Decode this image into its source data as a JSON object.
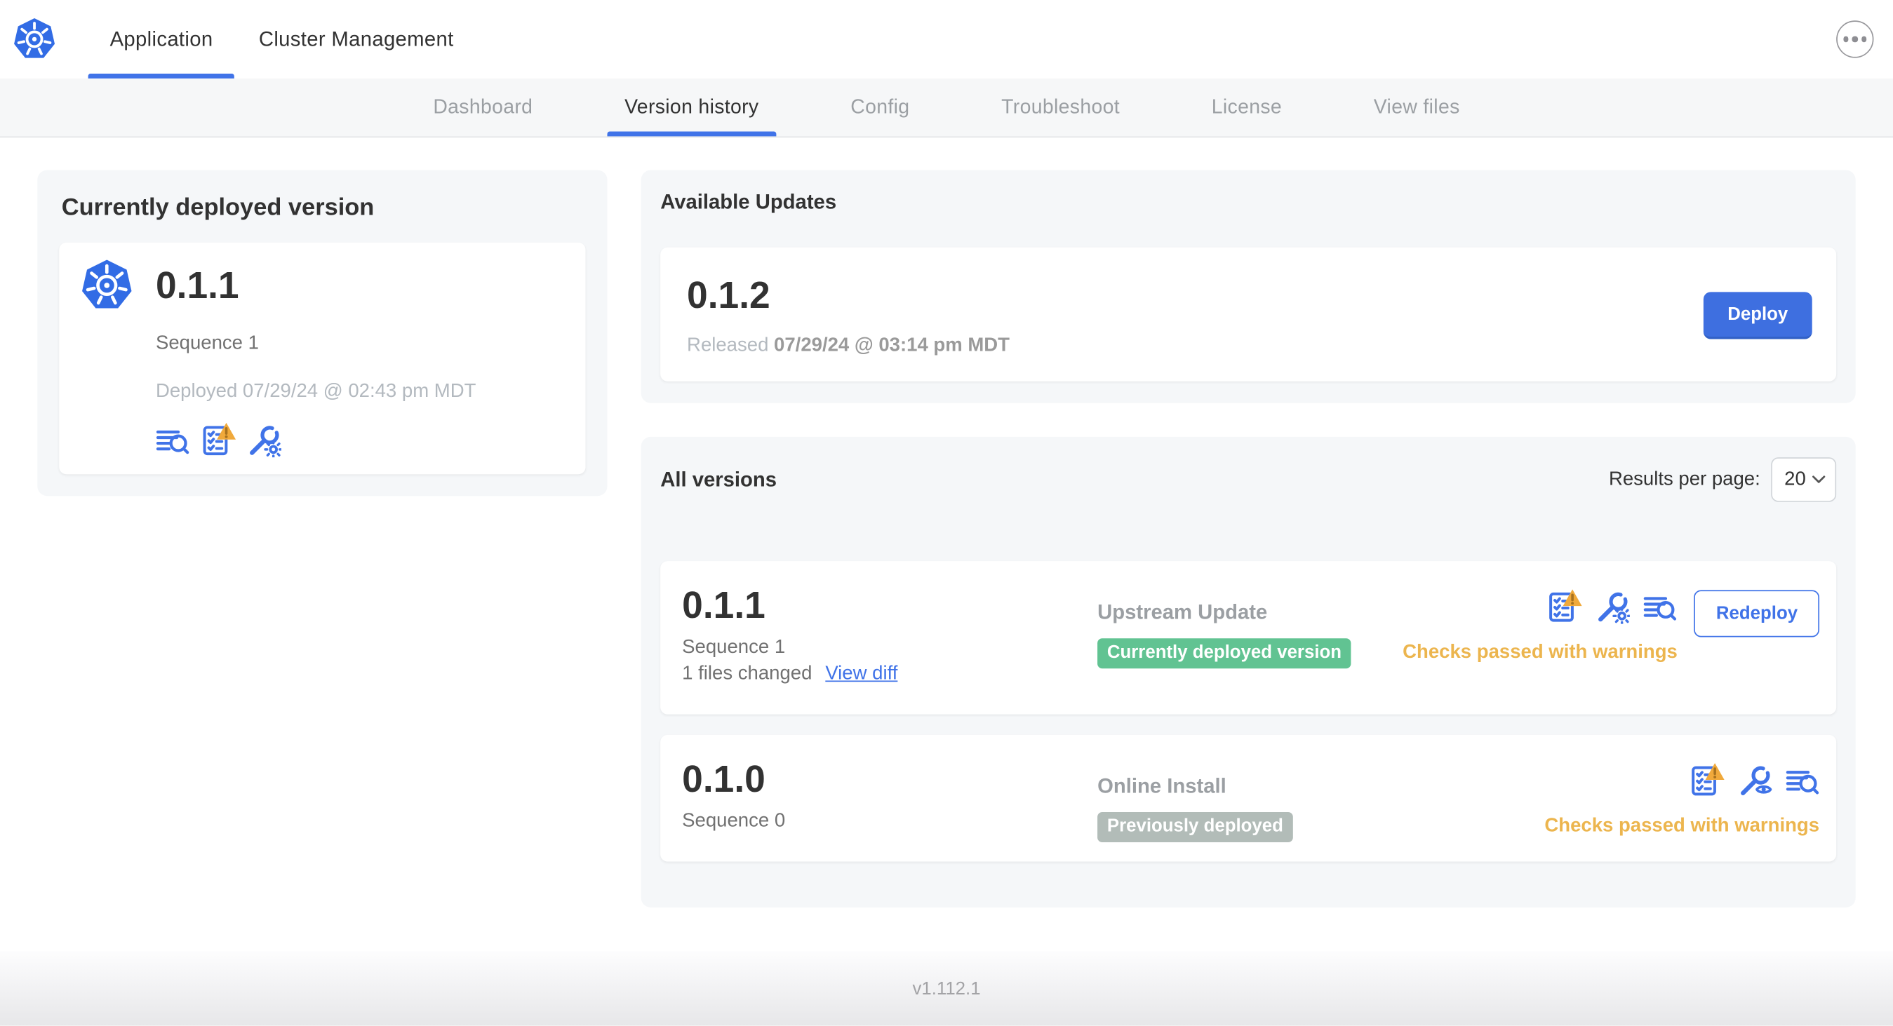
{
  "header": {
    "tabs": [
      {
        "label": "Application",
        "active": true
      },
      {
        "label": "Cluster Management",
        "active": false
      }
    ]
  },
  "subnav": {
    "items": [
      {
        "label": "Dashboard",
        "active": false
      },
      {
        "label": "Version history",
        "active": true
      },
      {
        "label": "Config",
        "active": false
      },
      {
        "label": "Troubleshoot",
        "active": false
      },
      {
        "label": "License",
        "active": false
      },
      {
        "label": "View files",
        "active": false
      }
    ]
  },
  "current_version": {
    "title": "Currently deployed version",
    "version": "0.1.1",
    "sequence": "Sequence 1",
    "deployed": "Deployed 07/29/24 @ 02:43 pm MDT"
  },
  "available_updates": {
    "title": "Available Updates",
    "version": "0.1.2",
    "released_prefix": "Released",
    "released_value": "07/29/24 @ 03:14 pm MDT",
    "deploy_label": "Deploy"
  },
  "all_versions": {
    "title": "All versions",
    "results_per_page_label": "Results per page:",
    "results_per_page_value": "20",
    "rows": [
      {
        "version": "0.1.1",
        "sequence": "Sequence 1",
        "files_changed": "1 files changed",
        "view_diff_label": "View diff",
        "source": "Upstream Update",
        "badge": "Currently deployed version",
        "badge_type": "green",
        "status": "Checks passed with warnings",
        "action_label": "Redeploy"
      },
      {
        "version": "0.1.0",
        "sequence": "Sequence 0",
        "source": "Online Install",
        "badge": "Previously deployed",
        "badge_type": "gray",
        "status": "Checks passed with warnings"
      }
    ]
  },
  "footer": {
    "app_version": "v1.112.1"
  },
  "icons": {
    "app_logo": "kubernetes-logo",
    "more": "ellipsis-icon",
    "release_notes": "release-notes-icon",
    "preflight_warning": "preflight-checks-warning-icon",
    "edit_config": "wrench-gear-icon",
    "view_config": "wrench-eye-icon",
    "select_caret": "chevron-down-icon"
  },
  "colors": {
    "accent_blue": "#4073E8",
    "kubernetes_blue": "#326CE5",
    "badge_green": "#61C392",
    "badge_gray": "#B2BCB8",
    "warning_text": "#ECB54E",
    "warning_triangle": "#F0A93B"
  }
}
